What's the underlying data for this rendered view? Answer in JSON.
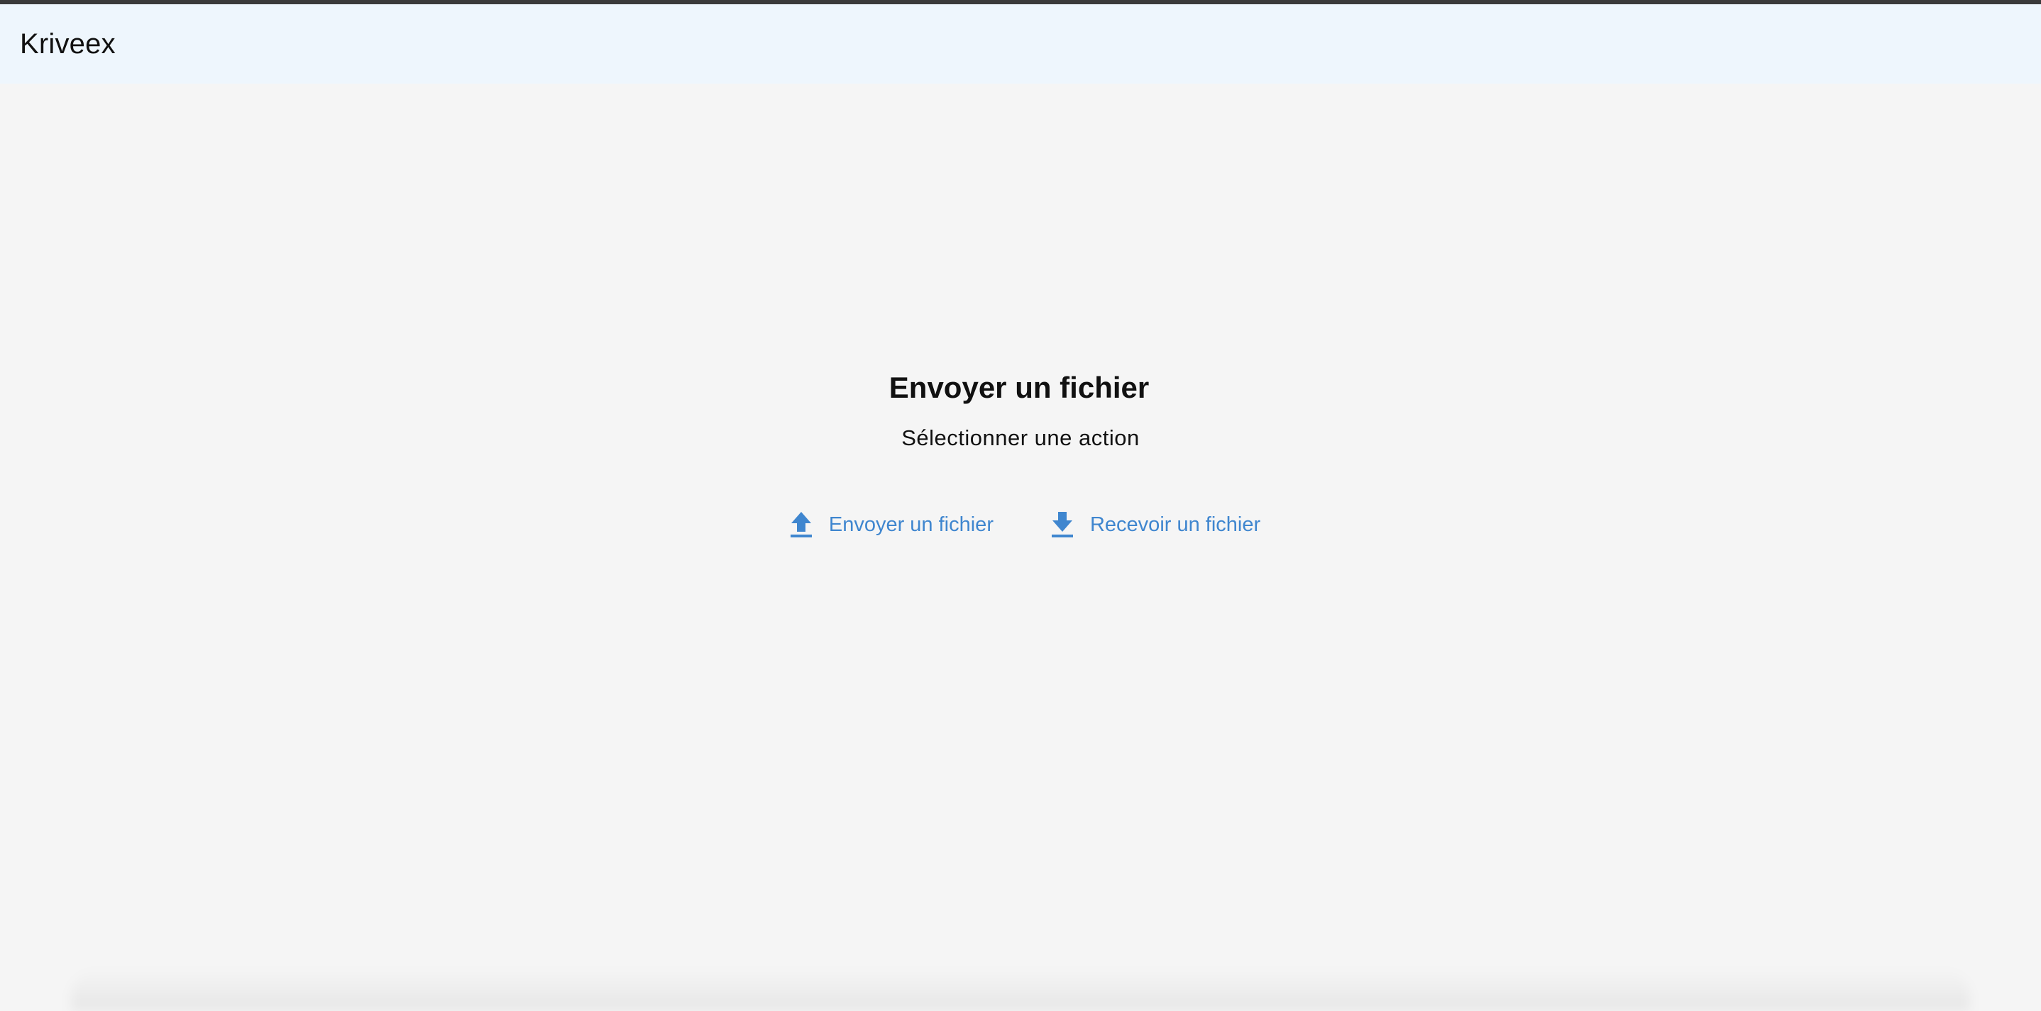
{
  "app": {
    "title": "Kriveex"
  },
  "main": {
    "heading": "Envoyer un fichier",
    "subheading": "Sélectionner une action",
    "actions": [
      {
        "label": "Envoyer un fichier",
        "icon": "upload-icon"
      },
      {
        "label": "Recevoir un fichier",
        "icon": "download-icon"
      }
    ]
  },
  "colors": {
    "appbar_bg": "#eef6fd",
    "page_bg": "#f5f5f5",
    "accent": "#3f86cf"
  }
}
